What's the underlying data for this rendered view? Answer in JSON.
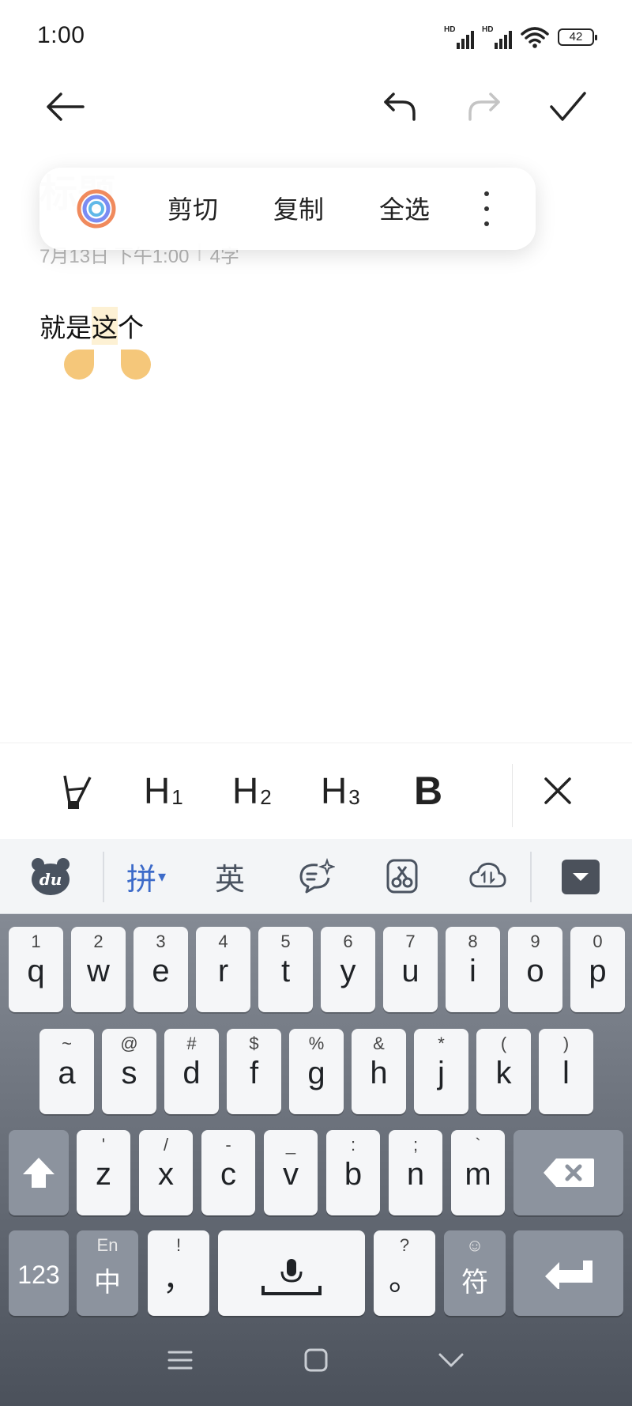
{
  "status_bar": {
    "time": "1:00",
    "signal1_label": "HD",
    "signal2_label": "HD",
    "battery": "42"
  },
  "note": {
    "title_placeholder": "标题",
    "date": "7月13日 下午1:00",
    "separator": "|",
    "char_count": "4字",
    "body_before": "就是",
    "body_selected": "这",
    "body_after": "个"
  },
  "context_menu": {
    "cut": "剪切",
    "copy": "复制",
    "select_all": "全选"
  },
  "format_bar": {
    "h1": "H",
    "h1_sub": "1",
    "h2": "H",
    "h2_sub": "2",
    "h3": "H",
    "h3_sub": "3",
    "bold": "B"
  },
  "keyboard": {
    "toolbar": {
      "pinyin": "拼",
      "english": "英"
    },
    "row1": [
      {
        "main": "q",
        "sub": "1"
      },
      {
        "main": "w",
        "sub": "2"
      },
      {
        "main": "e",
        "sub": "3"
      },
      {
        "main": "r",
        "sub": "4"
      },
      {
        "main": "t",
        "sub": "5"
      },
      {
        "main": "y",
        "sub": "6"
      },
      {
        "main": "u",
        "sub": "7"
      },
      {
        "main": "i",
        "sub": "8"
      },
      {
        "main": "o",
        "sub": "9"
      },
      {
        "main": "p",
        "sub": "0"
      }
    ],
    "row2": [
      {
        "main": "a",
        "sub": "~"
      },
      {
        "main": "s",
        "sub": "@"
      },
      {
        "main": "d",
        "sub": "#"
      },
      {
        "main": "f",
        "sub": "$"
      },
      {
        "main": "g",
        "sub": "%"
      },
      {
        "main": "h",
        "sub": "&"
      },
      {
        "main": "j",
        "sub": "*"
      },
      {
        "main": "k",
        "sub": "("
      },
      {
        "main": "l",
        "sub": ")"
      }
    ],
    "row3": [
      {
        "main": "z",
        "sub": "'"
      },
      {
        "main": "x",
        "sub": "/"
      },
      {
        "main": "c",
        "sub": "-"
      },
      {
        "main": "v",
        "sub": "_"
      },
      {
        "main": "b",
        "sub": ":"
      },
      {
        "main": "n",
        "sub": ";"
      },
      {
        "main": "m",
        "sub": "`"
      }
    ],
    "num_key": "123",
    "lang_key_top": "En",
    "lang_key_main": "中",
    "comma_key_top": "!",
    "comma_key_main": "，",
    "period_key_top": "?",
    "period_key_main": "。",
    "symbol_key_top": "☺",
    "symbol_key_main": "符"
  },
  "colors": {
    "selection_highlight": "#fdf1d4",
    "selection_handle": "#f5c77a",
    "pinyin_accent": "#3d6bc9",
    "keyboard_bg_top": "#8d939d",
    "keyboard_bg_bottom": "#4b515b"
  }
}
